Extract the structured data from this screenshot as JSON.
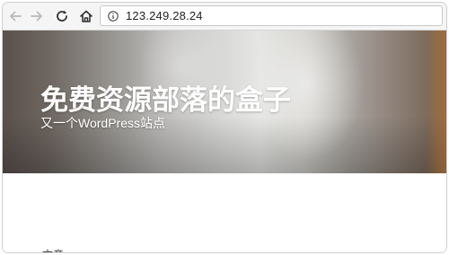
{
  "browser": {
    "url": "123.249.28.24",
    "info_icon": "info-circle-icon",
    "back_icon": "arrow-left-icon",
    "forward_icon": "arrow-right-icon",
    "reload_icon": "reload-icon",
    "home_icon": "home-icon"
  },
  "site": {
    "title": "免费资源部落的盒子",
    "tagline": "又一个WordPress站点"
  },
  "content": {
    "cut_off_text": "文章"
  },
  "colors": {
    "toolbar_bg": "#f5f5f5",
    "title_text": "#ffffff",
    "page_bg": "#ffffff"
  }
}
